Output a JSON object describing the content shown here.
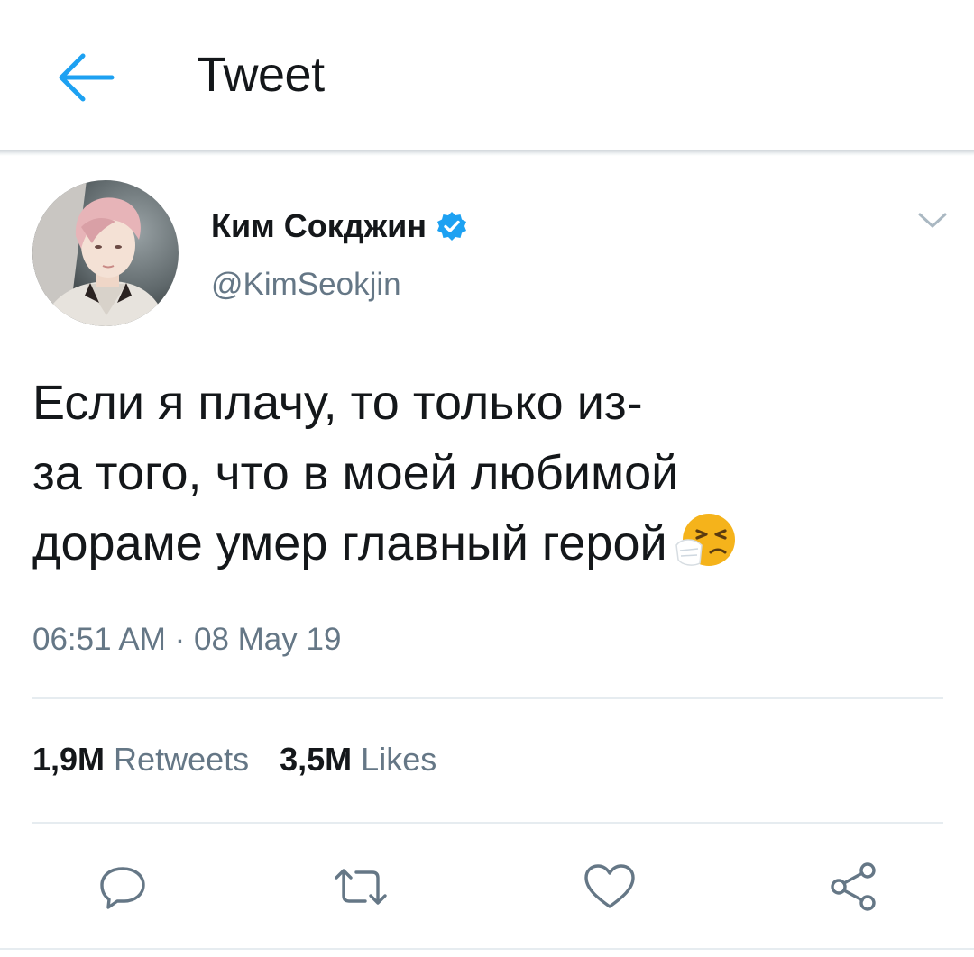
{
  "header": {
    "title": "Tweet",
    "back_icon": "arrow-left-icon"
  },
  "colors": {
    "accent": "#1DA1F2",
    "text_primary": "#14171A",
    "text_secondary": "#657786",
    "divider": "#E6ECF0"
  },
  "tweet": {
    "author": {
      "display_name": "Ким Сокджин",
      "handle": "@KimSeokjin",
      "verified": true
    },
    "text_lines": [
      "Если я плачу, то только из-",
      "за того, что в моей любимой",
      "дораме умер главный герой"
    ],
    "emoji": "sneezing-face",
    "timestamp": "06:51 AM · 08 May 19",
    "stats": {
      "retweets_count": "1,9M",
      "retweets_label": "Retweets",
      "likes_count": "3,5M",
      "likes_label": "Likes"
    },
    "actions": [
      "reply-icon",
      "retweet-icon",
      "like-icon",
      "share-icon"
    ]
  }
}
